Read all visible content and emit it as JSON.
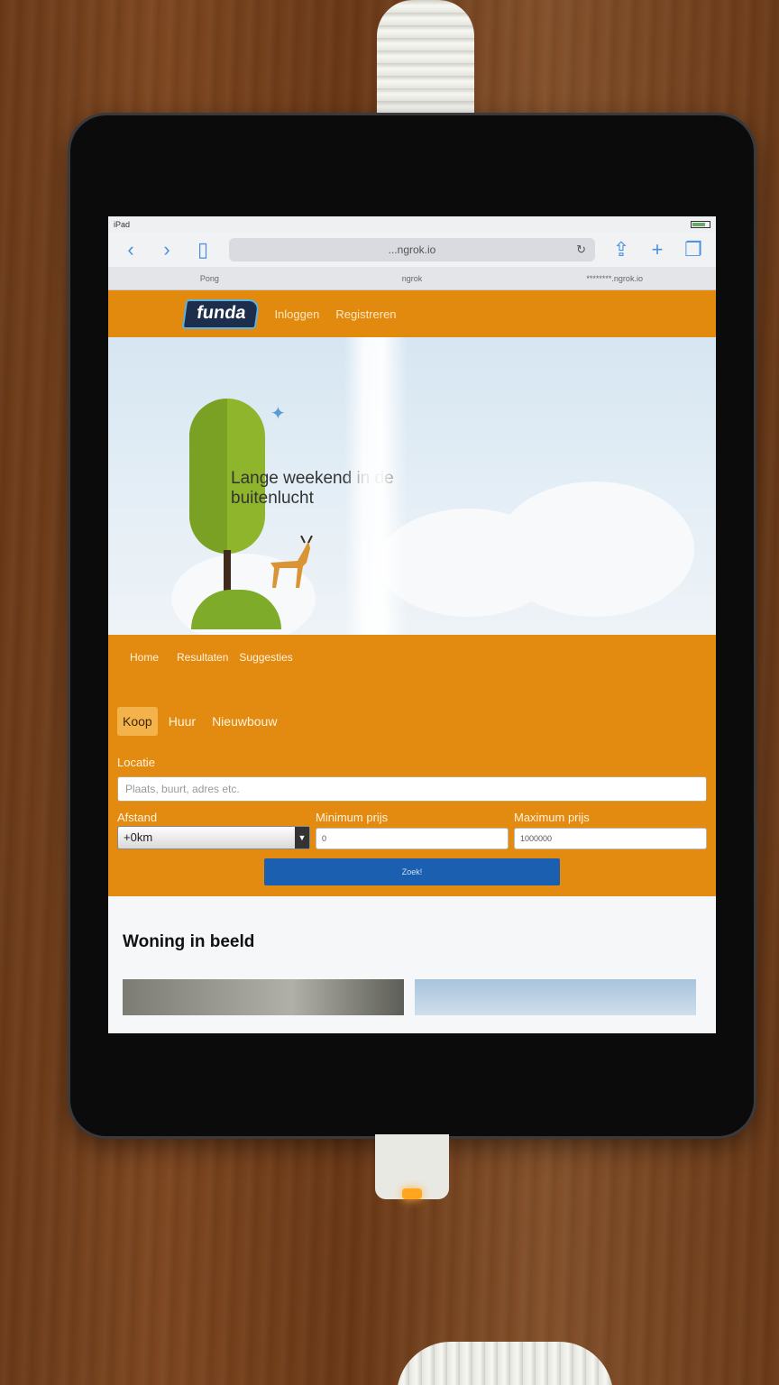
{
  "status_bar": {
    "device": "iPad"
  },
  "browser": {
    "url": "...ngrok.io",
    "tabs": [
      "Pong",
      "ngrok",
      "********.ngrok.io"
    ]
  },
  "header": {
    "logo": "funda",
    "links": [
      "Inloggen",
      "Registreren"
    ]
  },
  "hero": {
    "headline": "Lange weekend in de buitenlucht"
  },
  "sub_nav": {
    "items": [
      "Home",
      "Resultaten",
      "Suggesties"
    ]
  },
  "search": {
    "type_tabs": [
      "Koop",
      "Huur",
      "Nieuwbouw"
    ],
    "location_label": "Locatie",
    "location_placeholder": "Plaats, buurt, adres etc.",
    "distance_label": "Afstand",
    "distance_value": "+0km",
    "min_price_label": "Minimum prijs",
    "min_price_value": "0",
    "max_price_label": "Maximum prijs",
    "max_price_value": "1000000",
    "submit_label": "Zoek!"
  },
  "section": {
    "title": "Woning in beeld"
  },
  "colors": {
    "brand_orange": "#e28a0e",
    "brand_navy": "#1d2e4d",
    "button_blue": "#1b5fb0"
  }
}
